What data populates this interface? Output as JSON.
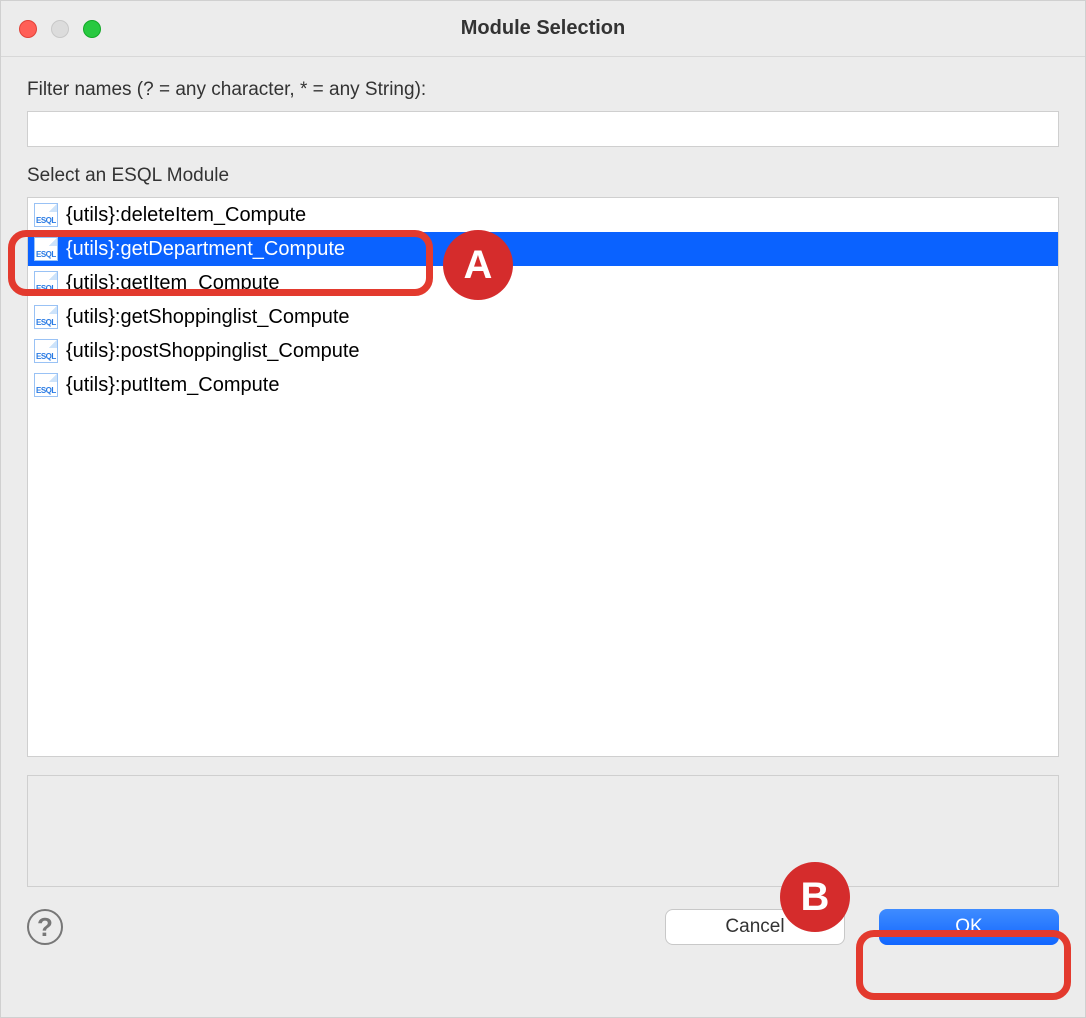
{
  "window": {
    "title": "Module Selection"
  },
  "filter": {
    "label": "Filter names (? = any character, * = any String):",
    "value": ""
  },
  "list": {
    "label": "Select an ESQL Module",
    "items": [
      {
        "text": "{utils}:deleteItem_Compute",
        "selected": false
      },
      {
        "text": "{utils}:getDepartment_Compute",
        "selected": true
      },
      {
        "text": "{utils}:getItem_Compute",
        "selected": false
      },
      {
        "text": "{utils}:getShoppinglist_Compute",
        "selected": false
      },
      {
        "text": "{utils}:postShoppinglist_Compute",
        "selected": false
      },
      {
        "text": "{utils}:putItem_Compute",
        "selected": false
      }
    ]
  },
  "buttons": {
    "cancel": "Cancel",
    "ok": "OK"
  },
  "help": {
    "glyph": "?"
  },
  "annotations": {
    "a": "A",
    "b": "B"
  }
}
